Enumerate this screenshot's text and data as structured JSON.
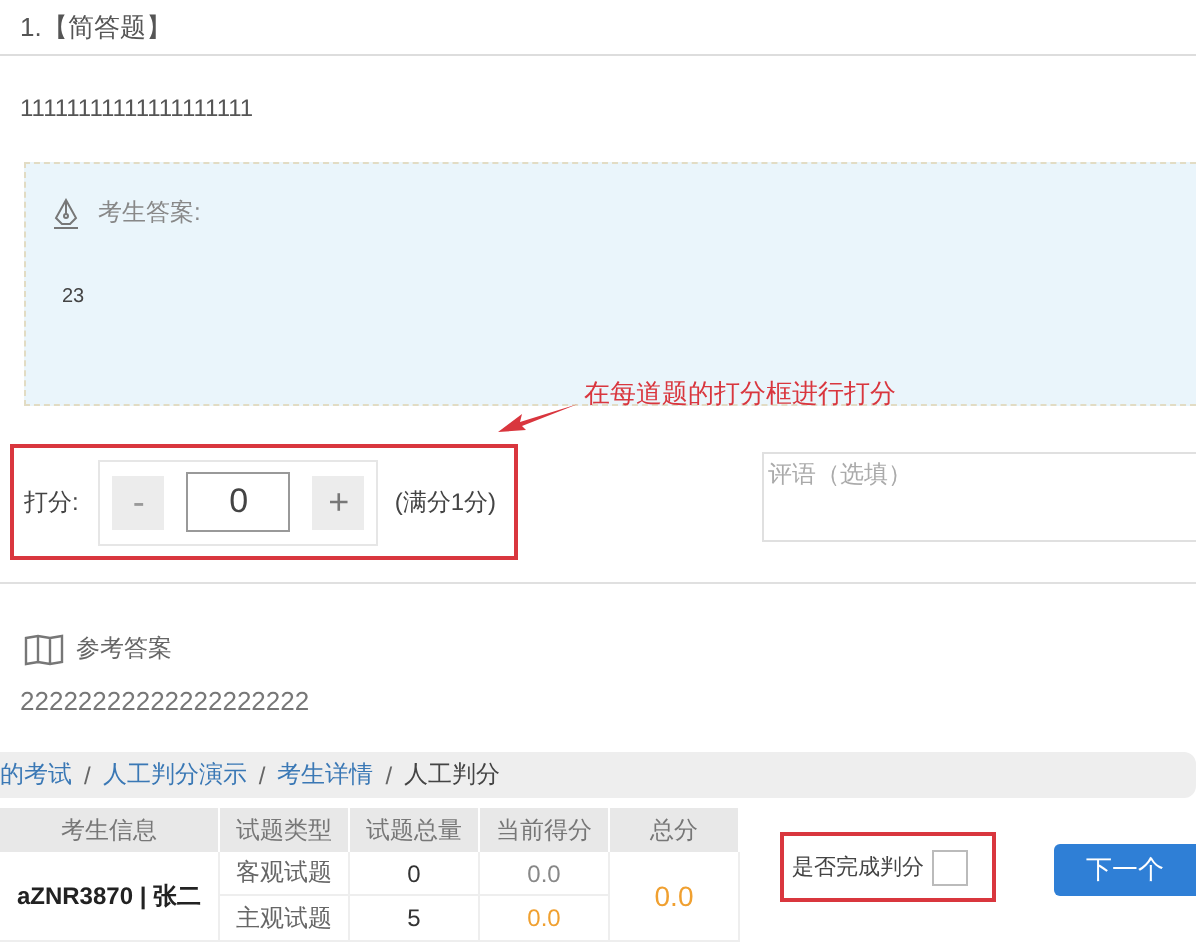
{
  "question": {
    "number": "1.",
    "type": "【简答题】",
    "stem": "11111111111111111111"
  },
  "student_answer": {
    "label": "考生答案:",
    "text": "23"
  },
  "annotation": {
    "text": "在每道题的打分框进行打分"
  },
  "scoring": {
    "label": "打分:",
    "minus": "-",
    "value": "0",
    "plus": "+",
    "max_note": "(满分1分)"
  },
  "comment": {
    "placeholder": "评语（选填）"
  },
  "reference": {
    "label": "参考答案",
    "text": "22222222222222222222"
  },
  "breadcrumb": [
    {
      "label": "的考试",
      "current": false
    },
    {
      "separator": "/",
      "label": "人工判分演示",
      "current": false
    },
    {
      "separator": "/",
      "label": "考生详情",
      "current": false
    },
    {
      "separator": "/",
      "label": "人工判分",
      "current": true
    }
  ],
  "summary": {
    "columns": [
      "考生信息",
      "试题类型",
      "试题总量",
      "当前得分",
      "总分"
    ],
    "examinee": "aZNR3870 | 张二",
    "rows": [
      {
        "type": "客观试题",
        "count": "0",
        "current_score": "0.0",
        "color": "#888888"
      },
      {
        "type": "主观试题",
        "count": "5",
        "current_score": "0.0",
        "color": "#f0a030"
      }
    ],
    "total": "0.0"
  },
  "finish": {
    "label": "是否完成判分",
    "checked": false
  },
  "next_button": "下一个"
}
